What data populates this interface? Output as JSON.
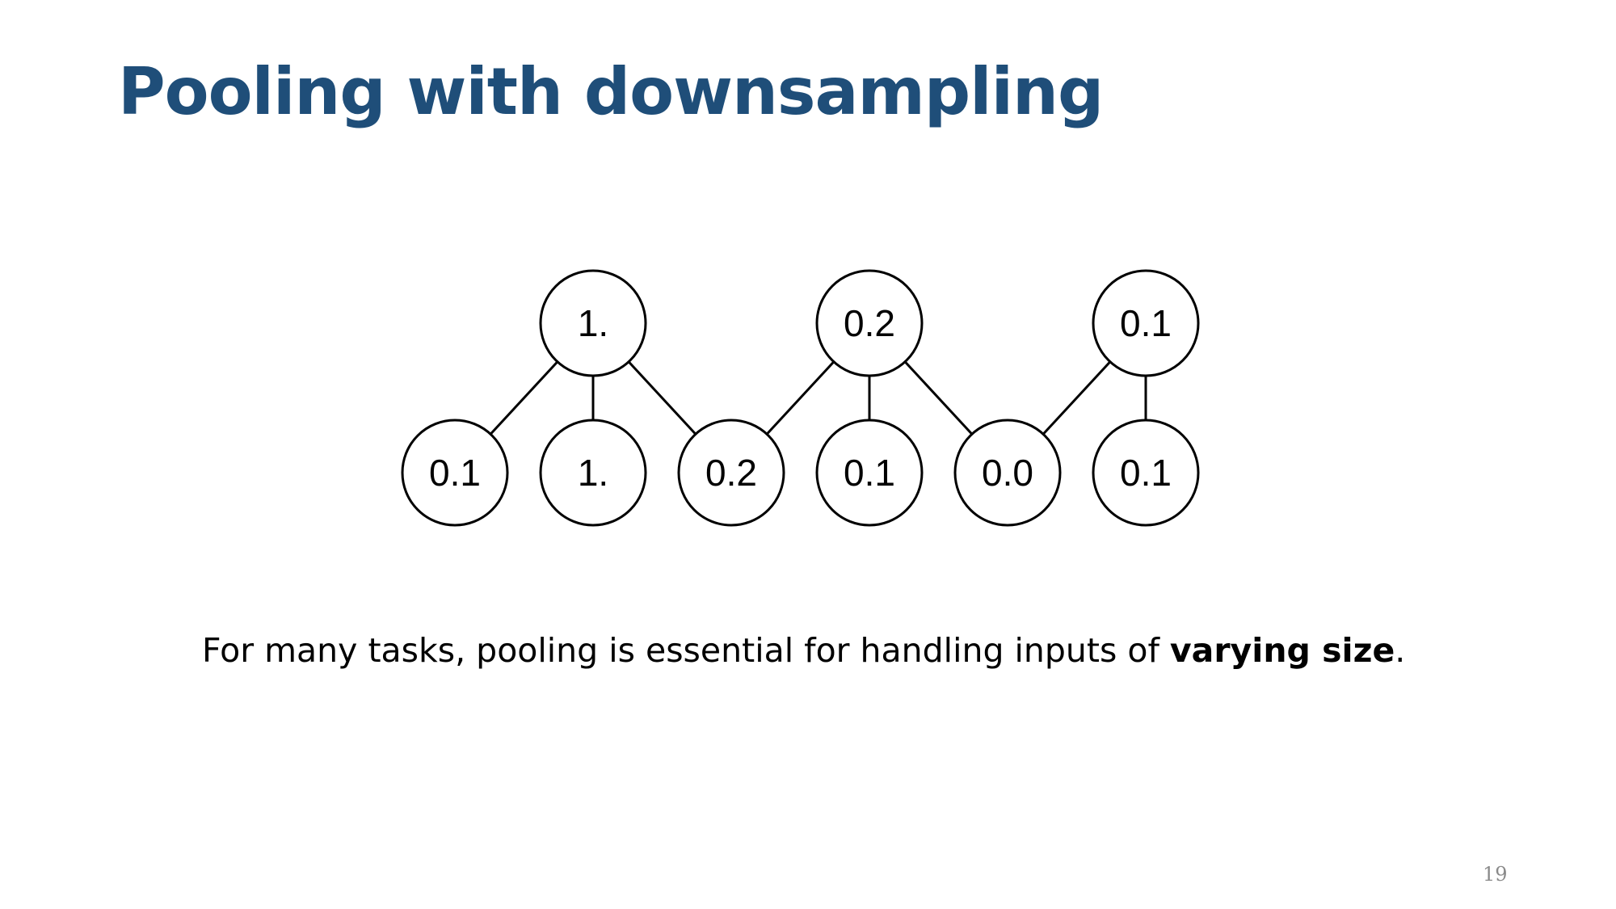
{
  "slide": {
    "title": "Pooling with downsampling",
    "caption_before": "For many tasks, pooling is essential for handling inputs of ",
    "caption_emphasis": "varying size",
    "caption_after": ".",
    "page_number": "19"
  },
  "diagram": {
    "pooled_nodes": [
      "1.",
      "0.2",
      "0.1"
    ],
    "input_nodes": [
      "0.1",
      "1.",
      "0.2",
      "0.1",
      "0.0",
      "0.1"
    ],
    "edges": [
      [
        0,
        0
      ],
      [
        0,
        1
      ],
      [
        0,
        2
      ],
      [
        1,
        2
      ],
      [
        1,
        3
      ],
      [
        1,
        4
      ],
      [
        2,
        4
      ],
      [
        2,
        5
      ]
    ]
  }
}
